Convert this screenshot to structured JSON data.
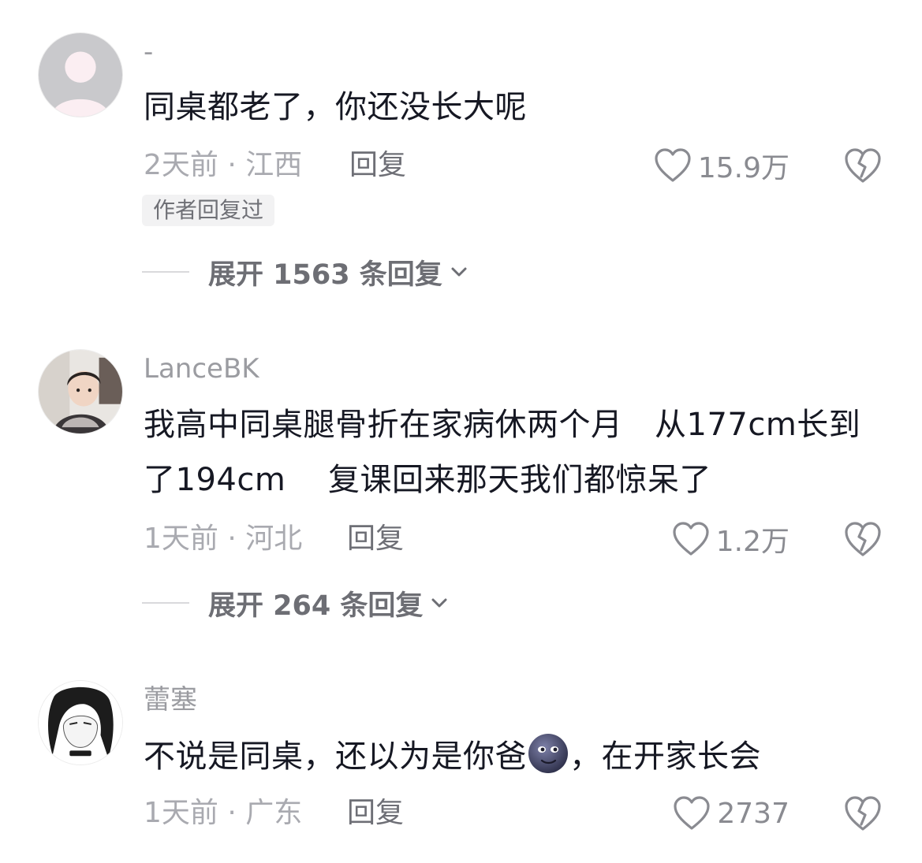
{
  "comments": [
    {
      "username": "-",
      "text": "同桌都老了，你还没长大呢",
      "meta": "2天前 · 江西",
      "reply_label": "回复",
      "likes": "15.9万",
      "badge": "作者回复过",
      "expand_label": "展开 1563 条回复"
    },
    {
      "username": "LanceBK",
      "text": "我高中同桌腿骨折在家病休两个月　从177cm长到了194cm　 复课回来那天我们都惊呆了",
      "meta": "1天前 · 河北",
      "reply_label": "回复",
      "likes": "1.2万",
      "expand_label": "展开 264 条回复"
    },
    {
      "username": "蕾塞",
      "text_before": "不说是同桌，还以为是你爸",
      "text_after": "，在开家长会",
      "emoji": "new-moon-face-emoji",
      "meta": "1天前 · 广东",
      "reply_label": "回复",
      "likes": "2737"
    }
  ],
  "icons": {
    "like": "heart-outline-icon",
    "dislike": "broken-heart-icon",
    "expand": "chevron-down-icon"
  },
  "colors": {
    "text": "#161823",
    "secondary": "#a9aab0",
    "icon": "#8a8b91"
  }
}
